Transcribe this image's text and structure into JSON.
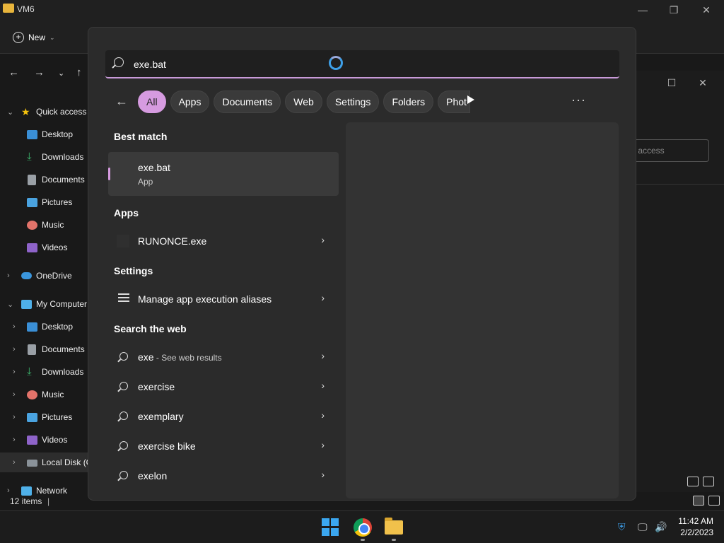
{
  "explorer": {
    "title": "VM6",
    "toolbar": {
      "new_label": "New"
    },
    "sidebar": {
      "items": [
        {
          "label": "Quick access"
        },
        {
          "label": "Desktop"
        },
        {
          "label": "Downloads"
        },
        {
          "label": "Documents"
        },
        {
          "label": "Pictures"
        },
        {
          "label": "Music"
        },
        {
          "label": "Videos"
        },
        {
          "label": "OneDrive"
        },
        {
          "label": "My Computer"
        },
        {
          "label": "Desktop"
        },
        {
          "label": "Documents"
        },
        {
          "label": "Downloads"
        },
        {
          "label": "Music"
        },
        {
          "label": "Pictures"
        },
        {
          "label": "Videos"
        },
        {
          "label": "Local Disk (C"
        },
        {
          "label": "Network"
        }
      ]
    },
    "status": "12 items",
    "bg_search_text": "ck access"
  },
  "search_flyout": {
    "query": "exe.bat",
    "filters": [
      "All",
      "Apps",
      "Documents",
      "Web",
      "Settings",
      "Folders",
      "Phot"
    ],
    "active_filter": "All",
    "best_match": {
      "heading": "Best match",
      "title": "exe.bat",
      "subtitle": "App"
    },
    "apps": {
      "heading": "Apps",
      "items": [
        {
          "label": "RUNONCE.exe"
        }
      ]
    },
    "settings": {
      "heading": "Settings",
      "items": [
        {
          "label": "Manage app execution aliases"
        }
      ]
    },
    "web": {
      "heading": "Search the web",
      "items": [
        {
          "label": "exe",
          "suffix": " - See web results"
        },
        {
          "label": "exercise",
          "suffix": ""
        },
        {
          "label": "exemplary",
          "suffix": ""
        },
        {
          "label": "exercise bike",
          "suffix": ""
        },
        {
          "label": "exelon",
          "suffix": ""
        }
      ]
    }
  },
  "taskbar": {
    "time": "11:42 AM",
    "date": "2/2/2023"
  },
  "colors": {
    "accent": "#d69be0",
    "background": "#2b2b2b"
  }
}
